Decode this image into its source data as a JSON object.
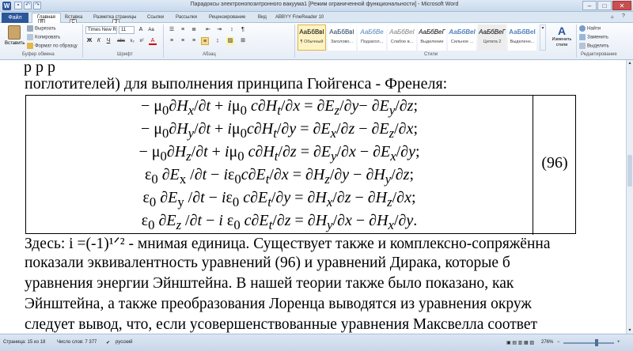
{
  "window": {
    "title": "Парадоксы электронопозитронного вакуума1 [Режим ограниченной функциональности] - Microsoft Word",
    "app_icon": "W",
    "qat_keytips": [
      "1",
      "2",
      "3",
      "4"
    ],
    "controls": [
      "–",
      "□",
      "✕"
    ]
  },
  "tabs": {
    "file": "Файл",
    "items": [
      "Главная",
      "Вставка",
      "Разметка страницы",
      "Ссылки",
      "Рассылки",
      "Рецензирование",
      "Вид",
      "ABBYY FineReader 10"
    ],
    "keytips": [
      "Я",
      "С",
      "З"
    ],
    "right_controls": [
      "▵",
      "?"
    ]
  },
  "ribbon": {
    "clipboard": {
      "label": "Буфер обмена",
      "paste": "Вставить",
      "cut": "Вырезать",
      "copy": "Копировать",
      "format_painter": "Формат по образцу"
    },
    "font": {
      "label": "Шрифт",
      "font_name": "Times New Ro",
      "font_size": "11",
      "bold": "Ж",
      "italic": "К",
      "underline": "Ч",
      "strike": "abc",
      "sub": "x₂",
      "sup": "x²",
      "color_a": "А",
      "grow": "A",
      "change_case": "Aa"
    },
    "paragraph": {
      "label": "Абзац"
    },
    "styles": {
      "label": "Стили",
      "items": [
        {
          "sample": "АаБбВвI",
          "name": "¶ Обычный"
        },
        {
          "sample": "АаБбВвI",
          "name": "Заголово..."
        },
        {
          "sample": "АаБбВе",
          "name": "Подзагол..."
        },
        {
          "sample": "АаБбВеІ",
          "name": "Слабое в..."
        },
        {
          "sample": "АаБбВеГ",
          "name": "Выделение"
        },
        {
          "sample": "АаБбВеІ",
          "name": "Сильное ..."
        },
        {
          "sample": "АаБбВеГ",
          "name": "Цитата 2"
        },
        {
          "sample": "АаБбВеІ",
          "name": "Выделенн..."
        }
      ],
      "change_styles": "Изменить стили"
    },
    "editing": {
      "label": "Редактирование",
      "find": "Найти",
      "replace": "Заменить",
      "select": "Выделить"
    }
  },
  "document": {
    "top_line": "р                  р                                        р",
    "heading_line": " поглотителей)  для выполнения принципа Гюйгенса - Френеля:",
    "equations": [
      "− μ₀∂Hₓ/∂t + iμ₀ c∂Hₜ/∂x = ∂E_z/∂y− ∂E_y/∂z;",
      "− μ₀∂H_y/∂t + iμ₀c∂Hₜ/∂y = ∂Eₓ/∂z − ∂E_z/∂x;",
      "− μ₀∂H_z/∂t + iμ₀ c∂Hₜ/∂z = ∂E_y/∂x − ∂Eₓ/∂y;",
      "ε₀ ∂Eₓ /∂t − iε₀c∂Eₜ/∂x = ∂H_z/∂y − ∂H_y/∂z;",
      "ε₀ ∂E_y /∂t − iε₀ c∂Eₜ/∂y = ∂Hₓ/∂z − ∂H_z/∂x;",
      "ε₀ ∂E_z /∂t − i ε₀ c∂Eₜ/∂z = ∂H_y/∂x − ∂Hₓ/∂y."
    ],
    "equation_number": "(96)",
    "paragraph_lines": [
      "  Здесь:  i  =(-1)¹ᐟ²  - мнимая единица. Существует также и комплексно-сопряжённа",
      "показали  эквивалентность  уравнений  (96)  и  уравнений  Дирака,  которые  б",
      "уравнения  энергии  Эйнштейна.  В  нашей  теории  также  было  показано,    как",
      "Эйнштейна,  а  также  преобразования  Лоренца  выводятся  из  уравнения  окруж",
      "следует  вывод,  что,  если  усовершенствованные  уравнения  Максвелла  соответ"
    ]
  },
  "statusbar": {
    "page": "Страница: 15 из 18",
    "words": "Число слов: 7 377",
    "language": "русский",
    "zoom": "276%",
    "zoom_minus": "−",
    "zoom_plus": "+"
  },
  "colors": {
    "accent": "#2b579a",
    "ribbon_bg": "#e6edf6",
    "selected_style": "#fdf3c4"
  }
}
